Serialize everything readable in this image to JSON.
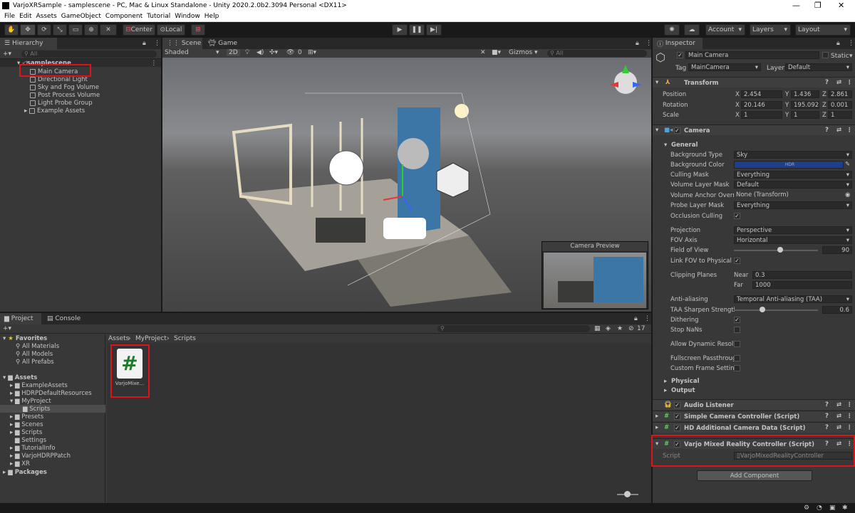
{
  "window": {
    "title": "VarjoXRSample - samplescene - PC, Mac & Linux Standalone - Unity 2020.2.0b2.3094 Personal <DX11>",
    "controls": [
      "—",
      "❐",
      "✕"
    ]
  },
  "menu": [
    "File",
    "Edit",
    "Assets",
    "GameObject",
    "Component",
    "Tutorial",
    "Window",
    "Help"
  ],
  "toolbar": {
    "tools": [
      "✋",
      "✥",
      "⟳",
      "⤡",
      "▭",
      "⊕",
      "✕"
    ],
    "pivot": "Center",
    "space": "Local",
    "grid": "⊞",
    "play": [
      "▶",
      "❚❚",
      "▶|"
    ],
    "account": "Account",
    "layers": "Layers",
    "layout": "Layout"
  },
  "hierarchy": {
    "tab": "Hierarchy",
    "add": "+▾",
    "search_placeholder": "All",
    "scene": "samplescene",
    "items": [
      "Main Camera",
      "Directional Light",
      "Sky and Fog Volume",
      "Post Process Volume",
      "Light Probe Group",
      "Example Assets"
    ]
  },
  "scene": {
    "tabs": [
      "Scene",
      "Game"
    ],
    "shading": "Shaded",
    "mode2d": "2D",
    "hidden_count": "0",
    "gizmos": "Gizmos",
    "search_placeholder": "All",
    "preview_title": "Camera Preview"
  },
  "project": {
    "tabs": [
      "Project",
      "Console"
    ],
    "add": "+▾",
    "favorites": {
      "label": "Favorites",
      "items": [
        "All Materials",
        "All Models",
        "All Prefabs"
      ]
    },
    "assets": {
      "label": "Assets",
      "items": [
        "ExampleAssets",
        "HDRPDefaultResources",
        "MyProject",
        "Scripts",
        "Presets",
        "Scenes",
        "Scripts",
        "Settings",
        "TutorialInfo",
        "VarjoHDRPPatch",
        "XR"
      ]
    },
    "packages": "Packages",
    "breadcrumb": [
      "Assets",
      "MyProject",
      "Scripts"
    ],
    "badge": "17",
    "file": {
      "glyph": "#",
      "name": "VarjoMixe..."
    }
  },
  "inspector": {
    "tab": "Inspector",
    "object": "Main Camera",
    "static": "Static",
    "tag_label": "Tag",
    "tag": "MainCamera",
    "layer_label": "Layer",
    "layer": "Default",
    "transform": {
      "title": "Transform",
      "rows": [
        {
          "label": "Position",
          "x": "2.454",
          "y": "1.436",
          "z": "2.861"
        },
        {
          "label": "Rotation",
          "x": "20.146",
          "y": "195.092",
          "z": "0.001"
        },
        {
          "label": "Scale",
          "x": "1",
          "y": "1",
          "z": "1"
        }
      ]
    },
    "camera": {
      "title": "Camera",
      "general": "General",
      "fields": [
        {
          "label": "Background Type",
          "value": "Sky"
        },
        {
          "label": "Background Color",
          "value": "HDR"
        },
        {
          "label": "Culling Mask",
          "value": "Everything"
        },
        {
          "label": "Volume Layer Mask",
          "value": "Default"
        },
        {
          "label": "Volume Anchor Overri",
          "value": "None (Transform)"
        },
        {
          "label": "Probe Layer Mask",
          "value": "Everything"
        },
        {
          "label": "Occlusion Culling",
          "value": "✓"
        },
        {
          "label": "Projection",
          "value": "Perspective"
        },
        {
          "label": "FOV Axis",
          "value": "Horizontal"
        },
        {
          "label": "Field of View",
          "value": "90"
        },
        {
          "label": "Link FOV to Physical C",
          "value": "✓"
        },
        {
          "label": "Clipping Planes",
          "near_label": "Near",
          "near": "0.3",
          "far_label": "Far",
          "far": "1000"
        },
        {
          "label": "Anti-aliasing",
          "value": "Temporal Anti-aliasing (TAA)"
        },
        {
          "label": "TAA Sharpen Strength",
          "value": "0.6"
        },
        {
          "label": "Dithering",
          "value": "✓"
        },
        {
          "label": "Stop NaNs",
          "value": ""
        },
        {
          "label": "Allow Dynamic Resolu",
          "value": ""
        },
        {
          "label": "Fullscreen Passthroug",
          "value": ""
        },
        {
          "label": "Custom Frame Setting",
          "value": ""
        }
      ],
      "physical": "Physical",
      "output": "Output"
    },
    "components": [
      "Audio Listener",
      "Simple Camera Controller (Script)",
      "HD Additional Camera Data (Script)",
      "Varjo Mixed Reality Controller (Script)"
    ],
    "script_label": "Script",
    "script_value": "VarjoMixedRealityController",
    "add_component": "Add Component"
  },
  "colors": {
    "accent": "#e0131d",
    "bg_color_field": "#1c3f8c"
  }
}
